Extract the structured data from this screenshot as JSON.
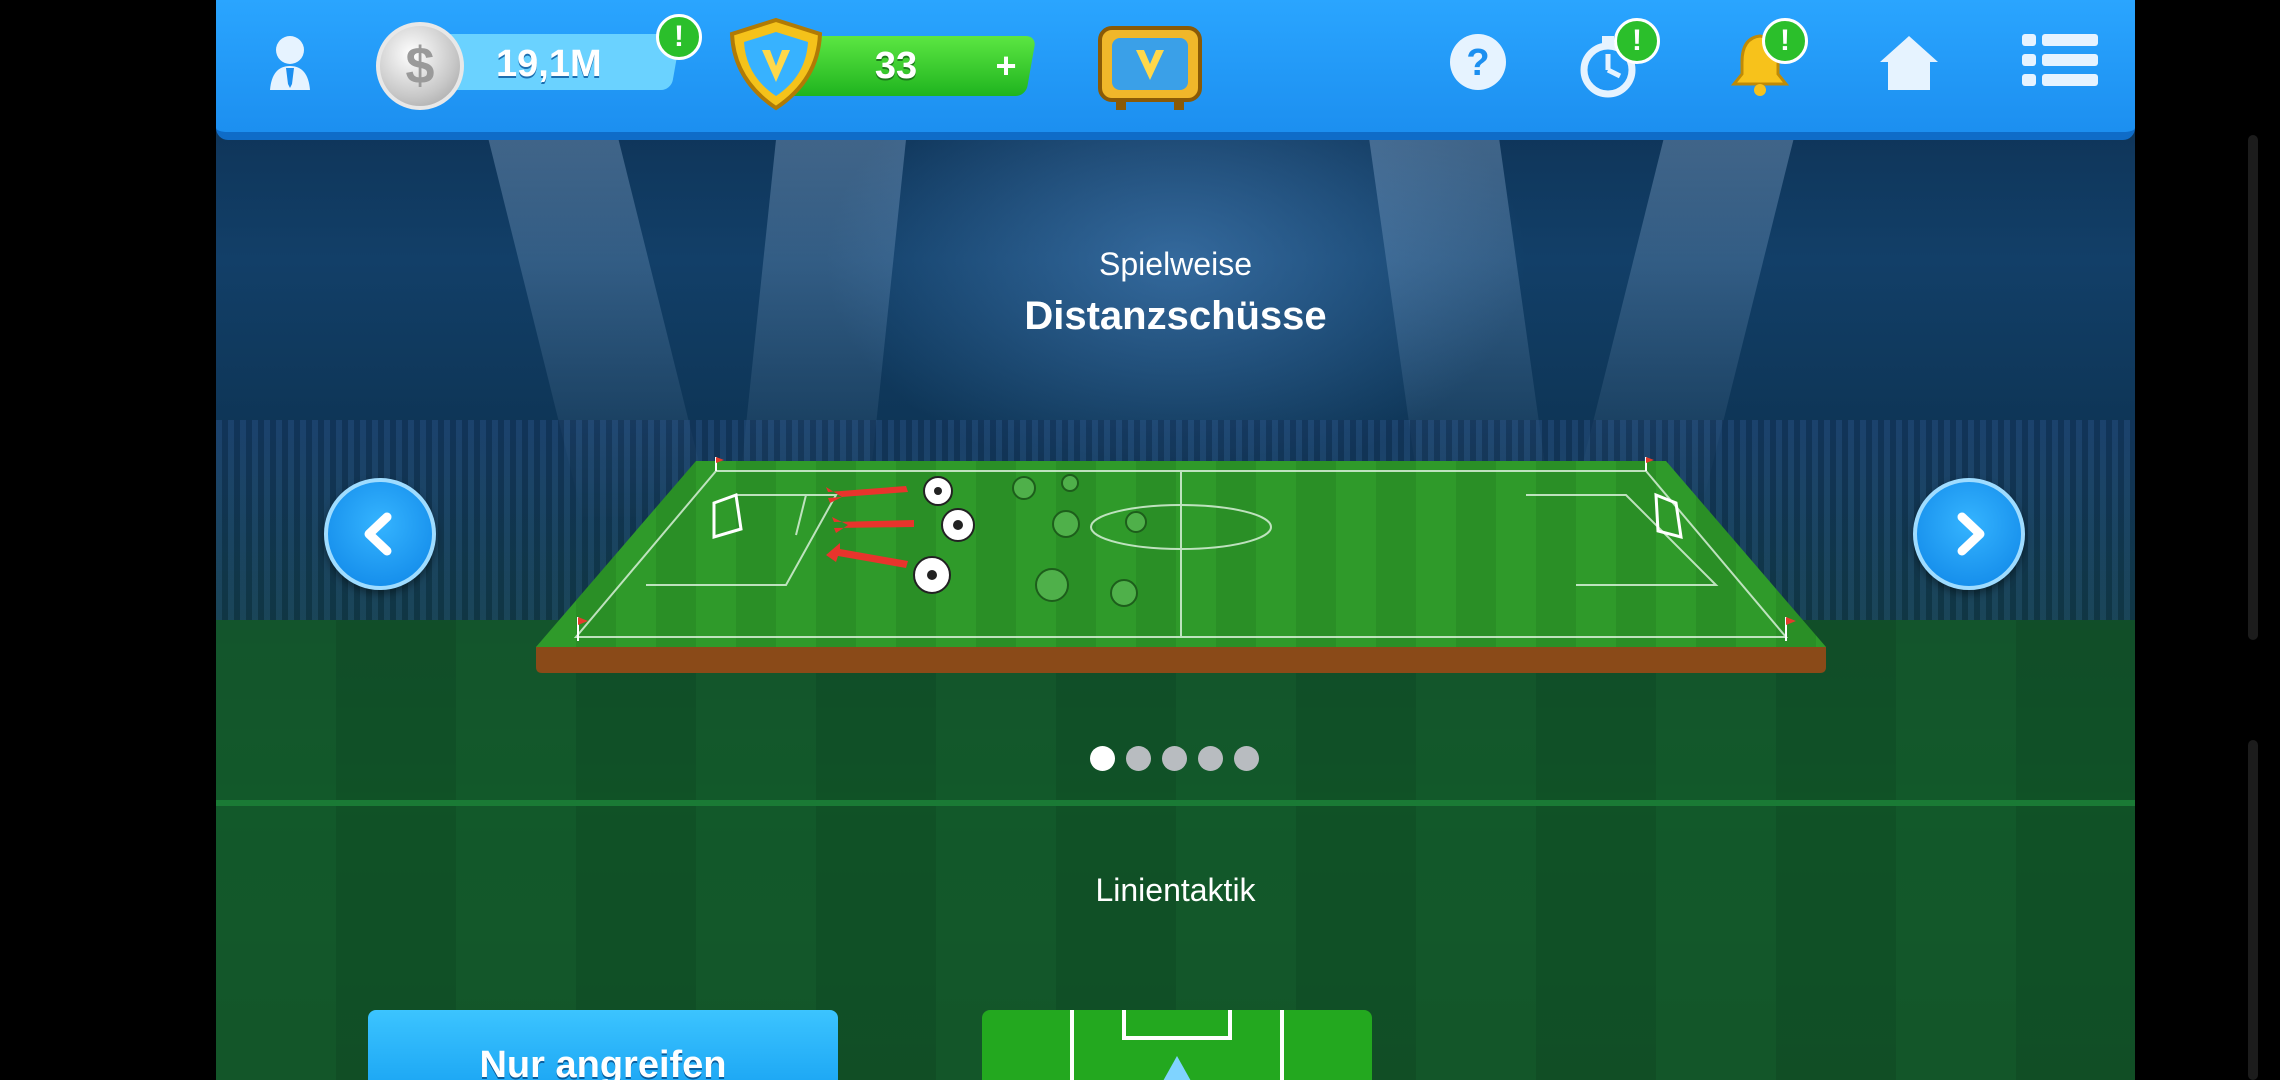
{
  "header": {
    "coins": "19,1M",
    "gems": "33",
    "gems_plus": "+",
    "alert_mark": "!"
  },
  "carousel": {
    "label": "Spielweise",
    "title": "Distanzschüsse",
    "page_count": 5,
    "active_page": 1
  },
  "tactic": {
    "label": "Linientaktik",
    "button_label": "Nur angreifen"
  },
  "icons": [
    "profile-icon",
    "coin-icon",
    "gem-shield-icon",
    "tv-icon",
    "help-icon",
    "stopwatch-icon",
    "bell-icon",
    "home-icon",
    "menu-icon",
    "chevron-left-icon",
    "chevron-right-icon",
    "soccer-ball-icon"
  ],
  "colors": {
    "topbar": "#1c8ff0",
    "accent_green": "#2bbf2b",
    "button_blue": "#16a1f2"
  }
}
